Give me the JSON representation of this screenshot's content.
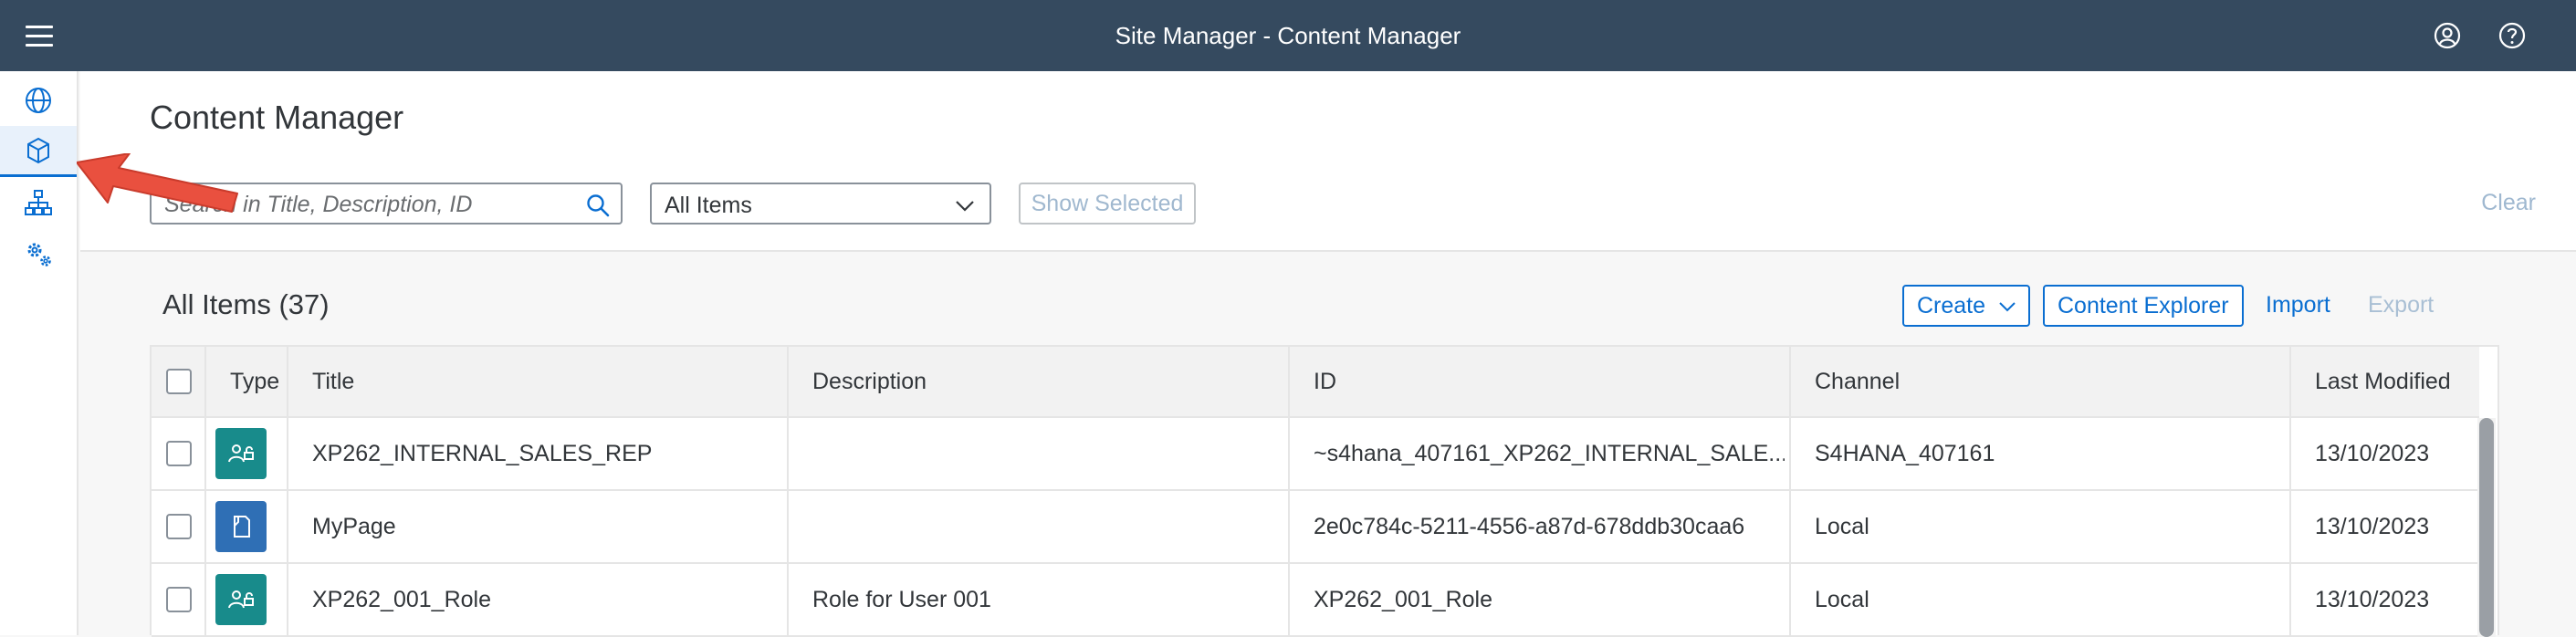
{
  "shell": {
    "title": "Site Manager - Content Manager",
    "icons": [
      "menu-icon",
      "user-icon",
      "help-icon"
    ]
  },
  "sidenav": {
    "items": [
      {
        "name": "globe-icon",
        "active": false
      },
      {
        "name": "content-cube-icon",
        "active": true
      },
      {
        "name": "sitemap-icon",
        "active": false
      },
      {
        "name": "settings-icon",
        "active": false
      }
    ]
  },
  "header": {
    "title": "Content Manager",
    "search_placeholder": "Search in Title, Description, ID",
    "filter_value": "All Items",
    "show_selected_label": "Show Selected",
    "clear_label": "Clear"
  },
  "list": {
    "title": "All Items (37)",
    "create_label": "Create",
    "content_explorer_label": "Content Explorer",
    "import_label": "Import",
    "export_label": "Export"
  },
  "table": {
    "columns": [
      "Type",
      "Title",
      "Description",
      "ID",
      "Channel",
      "Last Modified"
    ],
    "rows": [
      {
        "type_icon": "role-icon",
        "title": "XP262_INTERNAL_SALES_REP",
        "description": "",
        "id": "~s4hana_407161_XP262_INTERNAL_SALE...",
        "channel": "S4HANA_407161",
        "modified": "13/10/2023"
      },
      {
        "type_icon": "page-icon",
        "title": "MyPage",
        "description": "",
        "id": "2e0c784c-5211-4556-a87d-678ddb30caa6",
        "channel": "Local",
        "modified": "13/10/2023"
      },
      {
        "type_icon": "role-icon",
        "title": "XP262_001_Role",
        "description": "Role for User 001",
        "id": "XP262_001_Role",
        "channel": "Local",
        "modified": "13/10/2023"
      }
    ]
  },
  "colors": {
    "shell": "#354a5f",
    "accent": "#0a6ed1",
    "role_icon_bg": "#188b8b",
    "page_icon_bg": "#2f6fb5",
    "arrow": "#e9503f"
  }
}
